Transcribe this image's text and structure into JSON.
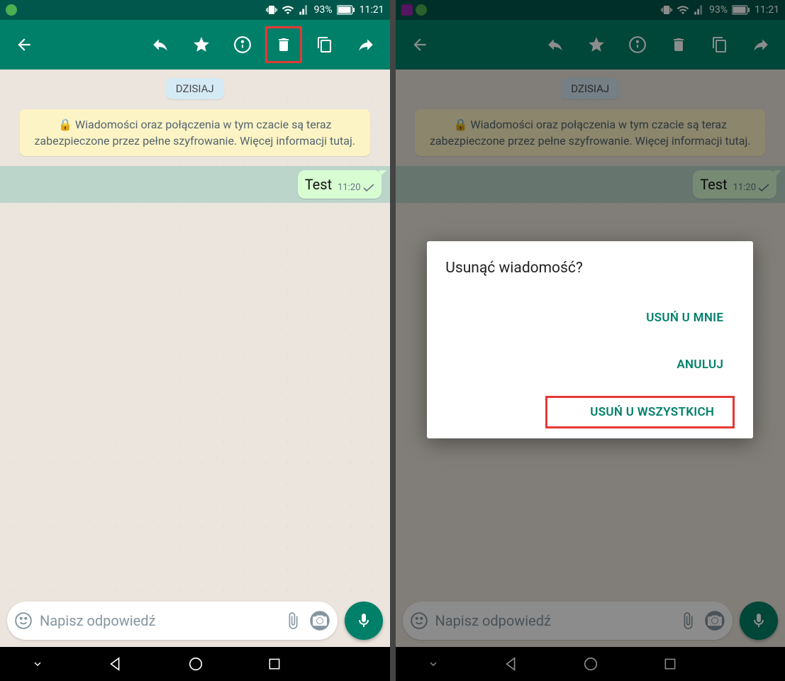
{
  "status": {
    "battery": "93%",
    "time": "11:21"
  },
  "chat": {
    "date_label": "DZISIAJ",
    "encryption_notice": "🔒 Wiadomości oraz połączenia w tym czacie są teraz zabezpieczone przez pełne szyfrowanie. Więcej informacji tutaj.",
    "message_text": "Test",
    "message_time": "11:20"
  },
  "composer": {
    "placeholder": "Napisz odpowiedź"
  },
  "dialog": {
    "title": "Usunąć wiadomość?",
    "delete_for_me": "USUŃ U MNIE",
    "cancel": "ANULUJ",
    "delete_for_everyone": "USUŃ U WSZYSTKICH"
  }
}
